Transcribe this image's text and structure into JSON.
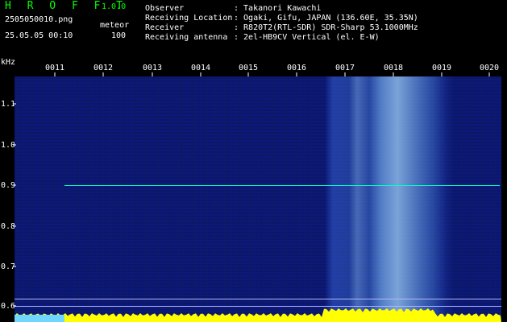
{
  "app": {
    "title": "H R O F F T",
    "version": "1.0.0"
  },
  "file": {
    "name": "2505050010.png",
    "datetime": "25.05.05 00:10"
  },
  "detection": {
    "label": "meteor",
    "count": "100"
  },
  "info": {
    "rows": [
      {
        "key": "Observer",
        "value": ": Takanori Kawachi"
      },
      {
        "key": "Receiving Location",
        "value": ": Ogaki, Gifu, JAPAN (136.60E, 35.35N)"
      },
      {
        "key": "Receiver",
        "value": ": R820T2(RTL-SDR) SDR-Sharp 53.1000MHz"
      },
      {
        "key": "Receiving antenna",
        "value": ": 2el-HB9CV Vertical (el. E-W)"
      }
    ]
  },
  "axis": {
    "unit": "kHz",
    "time_labels": [
      "0011",
      "0012",
      "0013",
      "0014",
      "0015",
      "0016",
      "0017",
      "0018",
      "0019",
      "0020"
    ],
    "freq_labels": [
      "1.1",
      "1.0",
      "0.9",
      "0.8",
      "0.7",
      "0.6"
    ]
  },
  "colors": {
    "background": "#000000",
    "spectrogram": "#0a1880",
    "carrier_line": "#00ffcc",
    "reference_line": "#b0b8ff",
    "echo_trace": "#ffff00"
  }
}
